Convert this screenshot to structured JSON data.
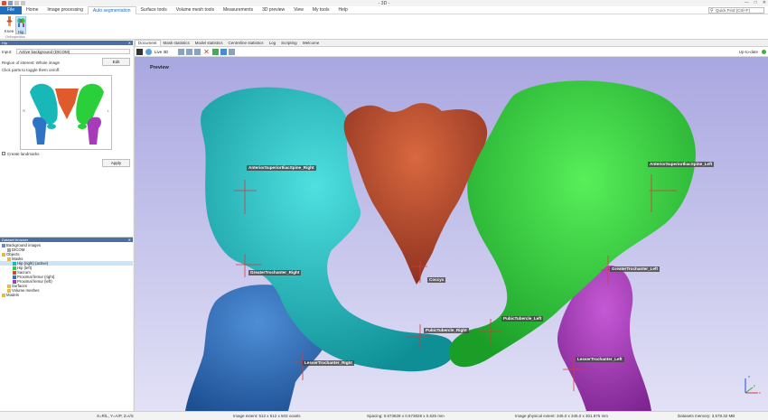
{
  "window": {
    "title": "- 3D -"
  },
  "ribbon": {
    "tabs": [
      "File",
      "Home",
      "Image processing",
      "Auto segmentation",
      "Surface tools",
      "Volume mesh tools",
      "Measurements",
      "3D preview",
      "View",
      "My tools",
      "Help"
    ],
    "search_placeholder": "Quick Find (Ctrl+F)",
    "buttons": {
      "knee": "Knee",
      "hip": "Hip"
    },
    "group_label": "Orthopedics"
  },
  "hip_panel": {
    "title": "Hip",
    "input_label": "Input:",
    "input_value": "Active background (DICOM)",
    "roi_label": "Region of interest: Whole image",
    "edit_label": "Edit",
    "hint": "Click parts to toggle them on/off.",
    "fig_left_marker": "R",
    "fig_right_marker": "L",
    "create_landmarks": "Create landmarks",
    "apply_label": "Apply"
  },
  "dataset_browser": {
    "title": "Dataset browser",
    "nodes": [
      {
        "label": "Background images",
        "depth": 0,
        "color": "#6a8cc0",
        "sel": false
      },
      {
        "label": "DICOM",
        "depth": 1,
        "color": "#a0a0a0",
        "sel": false
      },
      {
        "label": "Objects",
        "depth": 0,
        "color": "#e5b84a",
        "sel": false
      },
      {
        "label": "Masks",
        "depth": 1,
        "color": "#e5b84a",
        "sel": false
      },
      {
        "label": "Hip (right) (active)",
        "depth": 2,
        "color": "#19b8b8",
        "sel": true
      },
      {
        "label": "Hip (left)",
        "depth": 2,
        "color": "#2ad03a",
        "sel": false
      },
      {
        "label": "Sacrum",
        "depth": 2,
        "color": "#c24e33",
        "sel": false
      },
      {
        "label": "Proximal femur (right)",
        "depth": 2,
        "color": "#2f74c4",
        "sel": false
      },
      {
        "label": "Proximal femur (left)",
        "depth": 2,
        "color": "#a63cb8",
        "sel": false
      },
      {
        "label": "Surfaces",
        "depth": 1,
        "color": "#e5b84a",
        "sel": false
      },
      {
        "label": "Volume meshes",
        "depth": 1,
        "color": "#e5b84a",
        "sel": false
      },
      {
        "label": "Models",
        "depth": 0,
        "color": "#e5b84a",
        "sel": false
      }
    ]
  },
  "document": {
    "tabs": [
      "Document",
      "Mask statistics",
      "Model statistics",
      "Centreline statistics",
      "Log",
      "Scripting",
      "Welcome"
    ],
    "live_label": "Live 3D",
    "status": "Up-to-date",
    "preview_label": "Preview"
  },
  "landmarks": [
    {
      "name": "asis-right",
      "label": "AnteriorSuperiorIliacSpine_Right"
    },
    {
      "name": "asis-left",
      "label": "AnteriorSuperiorIliacSpine_Left"
    },
    {
      "name": "gt-right",
      "label": "GreaterTrochanter_Right"
    },
    {
      "name": "gt-left",
      "label": "GreaterTrochanter_Left"
    },
    {
      "name": "coccyx",
      "label": "Coccyx"
    },
    {
      "name": "pt-right",
      "label": "PubicTubercle_Right"
    },
    {
      "name": "pt-left",
      "label": "PubicTubercle_Left"
    },
    {
      "name": "lt-right",
      "label": "LesserTrochanter_Right"
    },
    {
      "name": "lt-left",
      "label": "LesserTrochanter_Left"
    }
  ],
  "axes": {
    "x": "x",
    "y": "y",
    "z": "z"
  },
  "colors": {
    "hip_right": "#19b8b8",
    "hip_left": "#2ad03a",
    "sacrum": "#c24e33",
    "femur_right": "#2f74c4",
    "femur_left": "#a63cb8",
    "accent": "#1e6fc2"
  },
  "statusbar": {
    "coords": "X=R/L, Y=A/P, Z=I/S",
    "extent": "Image extent: 512 x 512 x 503 voxels",
    "spacing": "Spacing: 0.673828 x 0.673828 x 0.625 mm",
    "physical": "Image physical extent: 345.0 x 345.0 x 301.875 mm",
    "memory": "Datasets memory: 3,578.32 MB"
  }
}
